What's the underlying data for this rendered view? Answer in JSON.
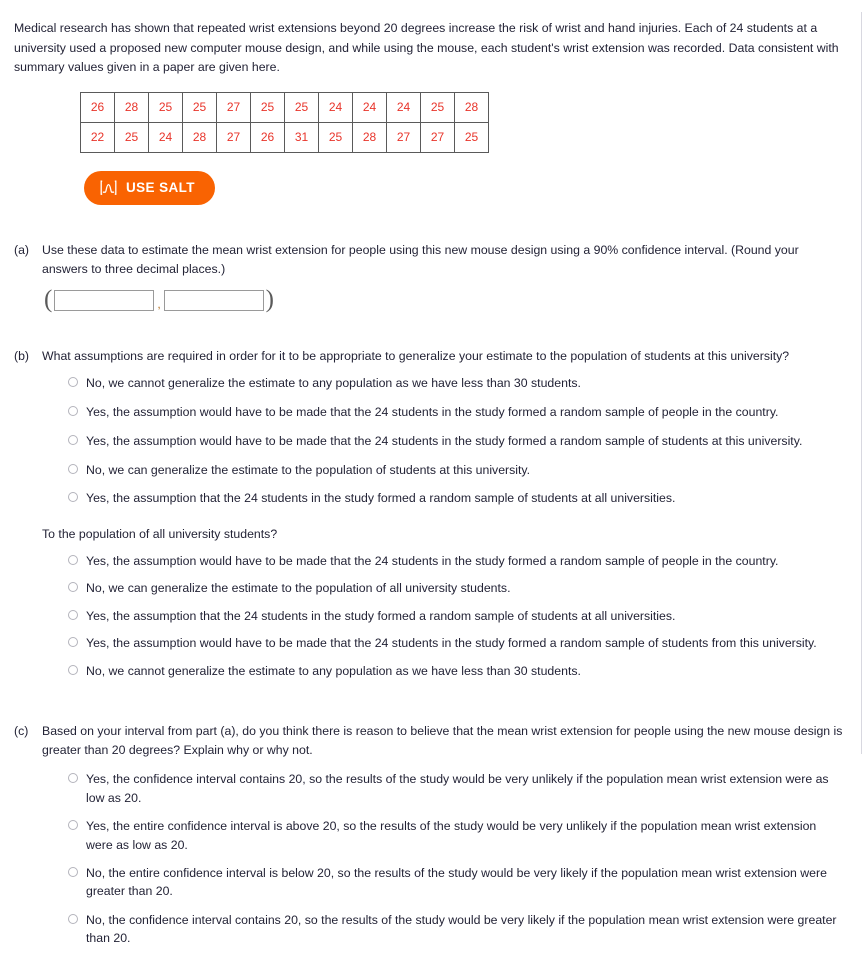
{
  "intro": {
    "paragraph": "Medical research has shown that repeated wrist extensions beyond 20 degrees increase the risk of wrist and hand injuries. Each of 24 students at a university used a proposed new computer mouse design, and while using the mouse, each student's wrist extension was recorded. Data consistent with summary values given in a paper are given here."
  },
  "data_table": {
    "rows": [
      [
        26,
        28,
        25,
        25,
        27,
        25,
        25,
        24,
        24,
        24,
        25,
        28
      ],
      [
        22,
        25,
        24,
        28,
        27,
        26,
        31,
        25,
        28,
        27,
        27,
        25
      ]
    ]
  },
  "salt_button": {
    "label": "USE SALT",
    "icon": "distribution-curve-icon",
    "background_color": "#f96302",
    "text_color": "#ffffff"
  },
  "parts": {
    "a": {
      "label": "(a)",
      "question": "Use these data to estimate the mean wrist extension for people using this new mouse design using a 90% confidence interval. (Round your answers to three decimal places.)",
      "open_paren": "(",
      "close_paren": ")",
      "separator": ",",
      "lower_value": "",
      "upper_value": "",
      "lower_placeholder": "",
      "upper_placeholder": ""
    },
    "b": {
      "label": "(b)",
      "question": "What assumptions are required in order for it to be appropriate to generalize your estimate to the population of students at this university?",
      "options_university": [
        "No, we cannot generalize the estimate to any population as we have less than 30 students.",
        "Yes, the assumption would have to be made that the 24 students in the study formed a random sample of people in the country.",
        "Yes, the assumption would have to be made that the 24 students in the study formed a random sample of students at this university.",
        "No, we can generalize the estimate to the population of students at this university.",
        "Yes, the assumption that the 24 students in the study formed a random sample of students at all universities."
      ],
      "subquestion": "To the population of all university students?",
      "options_all_universities": [
        "Yes, the assumption would have to be made that the 24 students in the study formed a random sample of people in the country.",
        "No, we can generalize the estimate to the population of all university students.",
        "Yes, the assumption that the 24 students in the study formed a random sample of students at all universities.",
        "Yes, the assumption would have to be made that the 24 students in the study formed a random sample of students from this university.",
        "No, we cannot generalize the estimate to any population as we have less than 30 students."
      ]
    },
    "c": {
      "label": "(c)",
      "question": "Based on your interval from part (a), do you think there is reason to believe that the mean wrist extension for people using the new mouse design is greater than 20 degrees? Explain why or why not.",
      "options": [
        "Yes, the confidence interval contains 20, so the results of the study would be very unlikely if the population mean wrist extension were as low as 20.",
        "Yes, the entire confidence interval is above 20, so the results of the study would be very unlikely if the population mean wrist extension were as low as 20.",
        "No, the entire confidence interval is below 20, so the results of the study would be very likely if the population mean wrist extension were greater than 20.",
        "No, the confidence interval contains 20, so the results of the study would be very likely if the population mean wrist extension were greater than 20."
      ]
    }
  }
}
